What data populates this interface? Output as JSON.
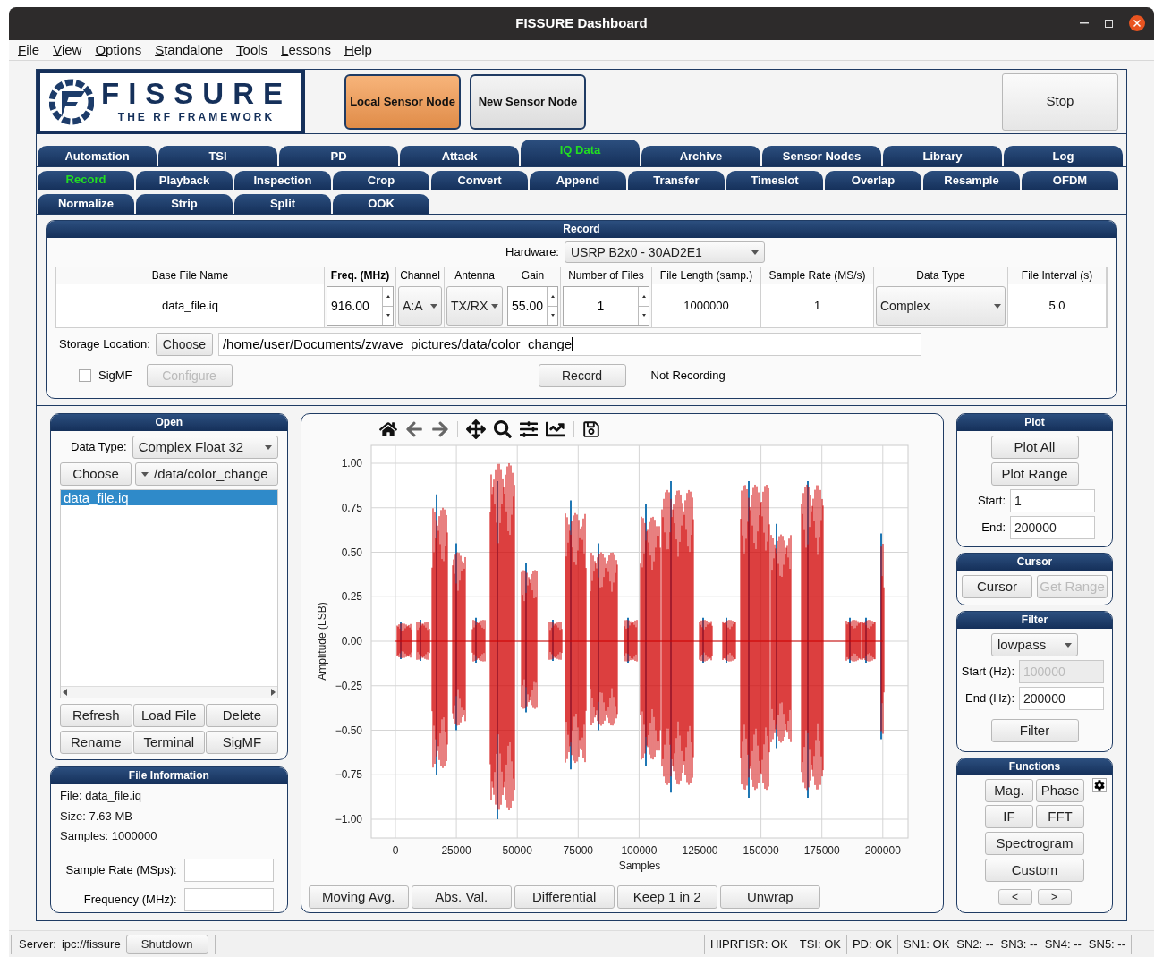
{
  "window": {
    "title": "FISSURE Dashboard"
  },
  "menu": [
    {
      "label": "File"
    },
    {
      "label": "View"
    },
    {
      "label": "Options"
    },
    {
      "label": "Standalone"
    },
    {
      "label": "Tools"
    },
    {
      "label": "Lessons"
    },
    {
      "label": "Help"
    }
  ],
  "header": {
    "logo": {
      "title": "FISSURE",
      "subtitle": "THE RF FRAMEWORK"
    },
    "node_buttons": [
      {
        "label": "Local Sensor Node",
        "selected": true
      },
      {
        "label": "New Sensor Node",
        "selected": false
      }
    ],
    "stop_button": "Stop"
  },
  "tabs": [
    {
      "label": "Automation",
      "selected": false
    },
    {
      "label": "TSI",
      "selected": false
    },
    {
      "label": "PD",
      "selected": false
    },
    {
      "label": "Attack",
      "selected": false
    },
    {
      "label": "IQ Data",
      "selected": true
    },
    {
      "label": "Archive",
      "selected": false
    },
    {
      "label": "Sensor Nodes",
      "selected": false
    },
    {
      "label": "Library",
      "selected": false
    },
    {
      "label": "Log",
      "selected": false
    }
  ],
  "subtabs": [
    {
      "label": "Record",
      "selected": true
    },
    {
      "label": "Playback",
      "selected": false
    },
    {
      "label": "Inspection",
      "selected": false
    },
    {
      "label": "Crop",
      "selected": false
    },
    {
      "label": "Convert",
      "selected": false
    },
    {
      "label": "Append",
      "selected": false
    },
    {
      "label": "Transfer",
      "selected": false
    },
    {
      "label": "Timeslot",
      "selected": false
    },
    {
      "label": "Overlap",
      "selected": false
    },
    {
      "label": "Resample",
      "selected": false
    },
    {
      "label": "OFDM",
      "selected": false
    },
    {
      "label": "Normalize",
      "selected": false
    },
    {
      "label": "Strip",
      "selected": false
    },
    {
      "label": "Split",
      "selected": false
    },
    {
      "label": "OOK",
      "selected": false
    }
  ],
  "record": {
    "title": "Record",
    "hardware": {
      "label": "Hardware:",
      "value": "USRP B2x0 - 30AD2E1"
    },
    "columns": [
      {
        "label": "Base File Name",
        "bold": false
      },
      {
        "label": "Freq. (MHz)",
        "bold": true
      },
      {
        "label": "Channel",
        "bold": false
      },
      {
        "label": "Antenna",
        "bold": false
      },
      {
        "label": "Gain",
        "bold": false
      },
      {
        "label": "Number of Files",
        "bold": false
      },
      {
        "label": "File Length (samp.)",
        "bold": false
      },
      {
        "label": "Sample Rate (MS/s)",
        "bold": false
      },
      {
        "label": "Data Type",
        "bold": false
      },
      {
        "label": "File Interval (s)",
        "bold": false
      }
    ],
    "cells": [
      {
        "kind": "text",
        "value": "data_file.iq"
      },
      {
        "kind": "spin",
        "value": "916.00"
      },
      {
        "kind": "combo",
        "value": "A:A"
      },
      {
        "kind": "combo",
        "value": "TX/RX"
      },
      {
        "kind": "spin",
        "value": "55.00"
      },
      {
        "kind": "spin",
        "value": "1"
      },
      {
        "kind": "text",
        "value": "1000000"
      },
      {
        "kind": "text",
        "value": "1"
      },
      {
        "kind": "combo",
        "value": "Complex"
      },
      {
        "kind": "text",
        "value": "5.0"
      }
    ],
    "storage": {
      "label": "Storage Location:",
      "button": "Choose",
      "value": "/home/user/Documents/zwave_pictures/data/color_change"
    },
    "sigmf": {
      "label": "SigMF",
      "checked": false
    },
    "configure": {
      "label": "Configure",
      "disabled": true
    },
    "record_button": "Record",
    "status": "Not Recording"
  },
  "open": {
    "title": "Open",
    "data_type": {
      "label": "Data Type:",
      "value": "Complex Float 32"
    },
    "choose": "Choose",
    "folder": "/data/color_change",
    "files": [
      {
        "name": "data_file.iq",
        "selected": true
      }
    ],
    "buttons": [
      "Refresh",
      "Load File",
      "Delete",
      "Rename",
      "Terminal",
      "SigMF"
    ]
  },
  "file_info": {
    "title": "File Information",
    "lines": [
      "File: data_file.iq",
      "Size: 7.63 MB",
      "Samples: 1000000"
    ],
    "fields": [
      {
        "label": "Sample Rate (MSps):"
      },
      {
        "label": "Frequency (MHz):"
      }
    ]
  },
  "plot": {
    "ylabel": "Amplitude (LSB)",
    "xlabel": "Samples",
    "yticks": [
      "1.00",
      "0.75",
      "0.50",
      "0.25",
      "0.00",
      "−0.25",
      "−0.50",
      "−0.75",
      "−1.00"
    ],
    "xticks": [
      "0",
      "25000",
      "50000",
      "75000",
      "100000",
      "125000",
      "150000",
      "175000",
      "200000"
    ],
    "buttons": [
      "Moving Avg.",
      "Abs. Val.",
      "Differential",
      "Keep 1 in 2",
      "Unwrap"
    ]
  },
  "plot_panel": {
    "title": "Plot",
    "buttons": [
      "Plot All",
      "Plot Range"
    ],
    "fields": [
      {
        "label": "Start:",
        "value": "1"
      },
      {
        "label": "End:",
        "value": "200000"
      }
    ]
  },
  "cursor": {
    "title": "Cursor",
    "buttons": [
      {
        "label": "Cursor",
        "disabled": false
      },
      {
        "label": "Get Range",
        "disabled": true
      }
    ]
  },
  "filter": {
    "title": "Filter",
    "type": "lowpass",
    "fields": [
      {
        "label": "Start (Hz):",
        "value": "100000",
        "disabled": true
      },
      {
        "label": "End (Hz):",
        "value": "200000",
        "disabled": false
      }
    ],
    "button": "Filter"
  },
  "functions": {
    "title": "Functions",
    "buttons": [
      "Mag.",
      "Phase",
      "IF",
      "FFT",
      "Spectrogram",
      "Custom"
    ],
    "nav": [
      "<",
      ">"
    ]
  },
  "status_bar": {
    "server_label": "Server:",
    "server": "ipc://fissure",
    "shutdown": "Shutdown",
    "items": [
      "HIPRFISR: OK",
      "TSI: OK",
      "PD: OK",
      "SN1: OK",
      "SN2: --",
      "SN3: --",
      "SN4: --",
      "SN5: --"
    ]
  }
}
